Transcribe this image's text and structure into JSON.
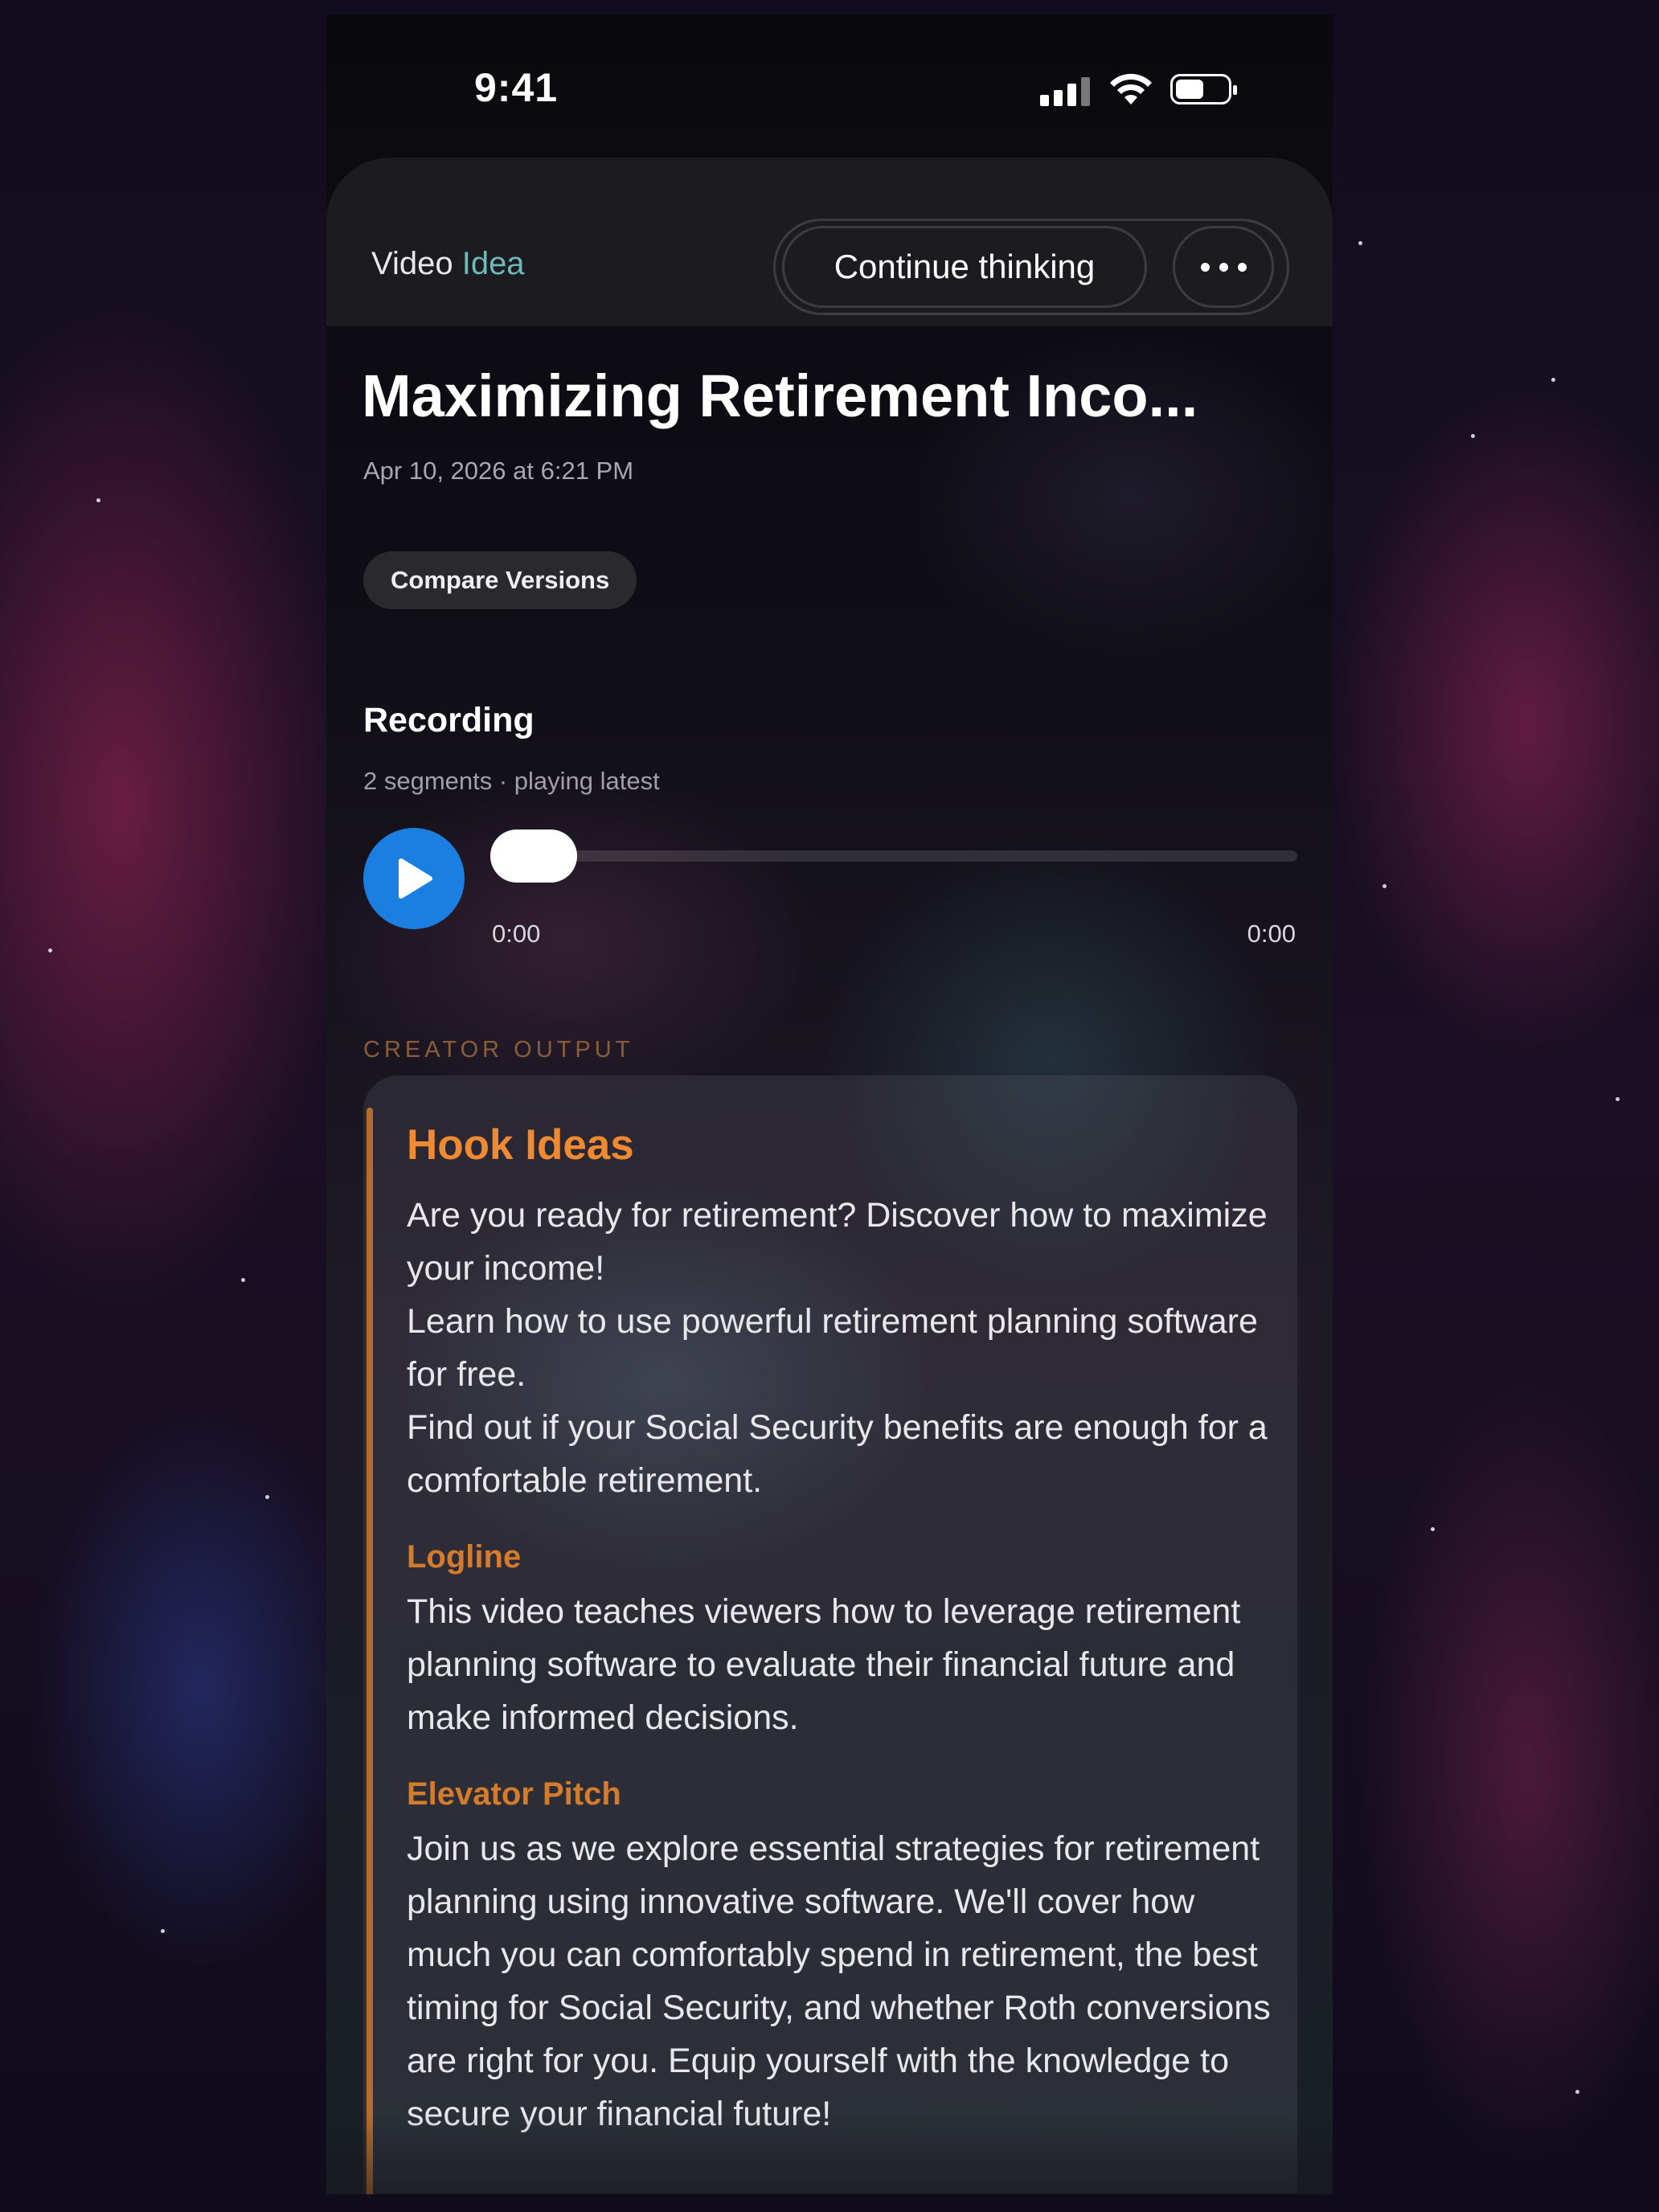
{
  "status_bar": {
    "time": "9:41"
  },
  "nav": {
    "title_part1": "Video ",
    "title_part2": "Idea",
    "continue_label": "Continue thinking"
  },
  "idea": {
    "title": "Maximizing Retirement Inco...",
    "date": "Apr 10, 2026 at 6:21 PM",
    "compare_label": "Compare Versions"
  },
  "recording": {
    "title": "Recording",
    "subtitle": "2 segments · playing latest",
    "current_time": "0:00",
    "duration": "0:00",
    "progress": 0
  },
  "output": {
    "section_label": "CREATOR OUTPUT",
    "hook_heading": "Hook Ideas",
    "hooks": [
      "Are you ready for retirement? Discover how to maximize your income!",
      "Learn how to use powerful retirement planning software for free.",
      "Find out if your Social Security benefits are enough for a comfortable retirement."
    ],
    "logline_heading": "Logline",
    "logline": "This video teaches viewers how to leverage retirement planning software to evaluate their financial future and make informed decisions.",
    "pitch_heading": "Elevator Pitch",
    "pitch": "Join us as we explore essential strategies for retirement planning using innovative software. We'll cover how much you can comfortably spend in retirement, the best timing for Social Security, and whether Roth conversions are right for you. Equip yourself with the knowledge to secure your financial future!"
  },
  "colors": {
    "accent_teal": "#6fb9b8",
    "play_blue": "#1a7fe0",
    "heading_orange": "#f08a32"
  }
}
